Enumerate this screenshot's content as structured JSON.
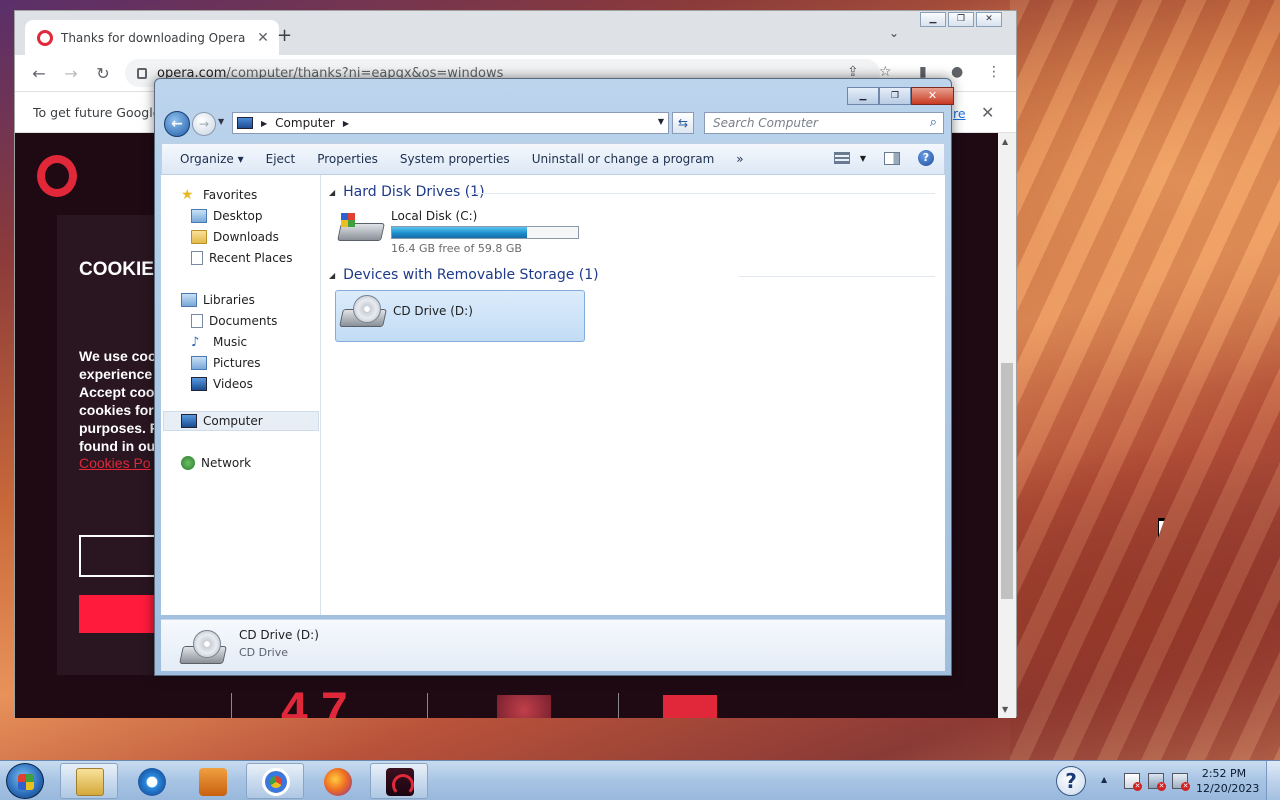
{
  "chrome": {
    "tab_title": "Thanks for downloading Opera",
    "tab_close": "✕",
    "new_tab": "+",
    "url_host": "opera.com",
    "url_path": "/computer/thanks?ni=eapgx&os=windows",
    "infobar_text": "To get future Google",
    "infobar_link": "re",
    "page": {
      "cookie_title": "COOKIE",
      "cookie_text": "We use coo\nexperience\nAccept coo\ncookies for\npurposes. F\nfound in ou",
      "cookie_link": "Cookies Po",
      "bottom_number": "4.7"
    }
  },
  "explorer": {
    "address": "Computer",
    "search_placeholder": "Search Computer",
    "commands": [
      "Organize",
      "Eject",
      "Properties",
      "System properties",
      "Uninstall or change a program"
    ],
    "more": "»",
    "nav": {
      "favorites": "Favorites",
      "desktop": "Desktop",
      "downloads": "Downloads",
      "recent": "Recent Places",
      "libraries": "Libraries",
      "documents": "Documents",
      "music": "Music",
      "pictures": "Pictures",
      "videos": "Videos",
      "computer": "Computer",
      "network": "Network"
    },
    "groups": {
      "hdd": "Hard Disk Drives (1)",
      "removable": "Devices with Removable Storage (1)"
    },
    "drives": {
      "local_name": "Local Disk (C:)",
      "local_free": "16.4 GB free of 59.8 GB",
      "local_used_fraction": 0.726,
      "cd_name": "CD Drive (D:)"
    },
    "details": {
      "name": "CD Drive (D:)",
      "type": "CD Drive"
    }
  },
  "taskbar": {
    "time": "2:52 PM",
    "date": "12/20/2023",
    "help": "?"
  }
}
